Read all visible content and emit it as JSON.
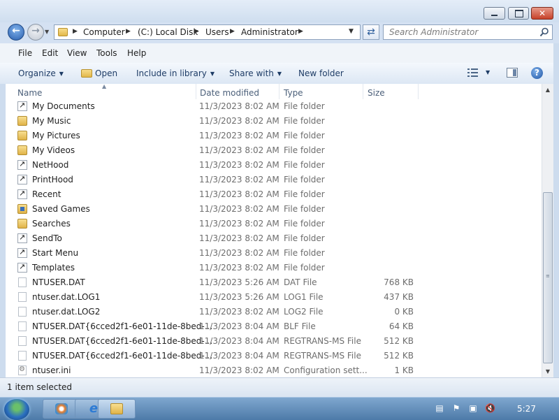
{
  "address": {
    "crumbs": [
      "Computer",
      "(C:) Local Disk",
      "Users",
      "Administrator"
    ]
  },
  "search": {
    "placeholder": "Search Administrator"
  },
  "menu": {
    "file": "File",
    "edit": "Edit",
    "view": "View",
    "tools": "Tools",
    "help": "Help"
  },
  "toolbar": {
    "organize": "Organize",
    "open": "Open",
    "include": "Include in library",
    "share": "Share with",
    "new_folder": "New folder"
  },
  "columns": {
    "name": "Name",
    "date": "Date modified",
    "type": "Type",
    "size": "Size"
  },
  "files": [
    {
      "name": "My Documents",
      "date": "11/3/2023 8:02 AM",
      "type": "File folder",
      "size": "",
      "icon": "shortcut"
    },
    {
      "name": "My Music",
      "date": "11/3/2023 8:02 AM",
      "type": "File folder",
      "size": "",
      "icon": "folder"
    },
    {
      "name": "My Pictures",
      "date": "11/3/2023 8:02 AM",
      "type": "File folder",
      "size": "",
      "icon": "folder"
    },
    {
      "name": "My Videos",
      "date": "11/3/2023 8:02 AM",
      "type": "File folder",
      "size": "",
      "icon": "folder"
    },
    {
      "name": "NetHood",
      "date": "11/3/2023 8:02 AM",
      "type": "File folder",
      "size": "",
      "icon": "shortcut"
    },
    {
      "name": "PrintHood",
      "date": "11/3/2023 8:02 AM",
      "type": "File folder",
      "size": "",
      "icon": "shortcut"
    },
    {
      "name": "Recent",
      "date": "11/3/2023 8:02 AM",
      "type": "File folder",
      "size": "",
      "icon": "shortcut"
    },
    {
      "name": "Saved Games",
      "date": "11/3/2023 8:02 AM",
      "type": "File folder",
      "size": "",
      "icon": "special"
    },
    {
      "name": "Searches",
      "date": "11/3/2023 8:02 AM",
      "type": "File folder",
      "size": "",
      "icon": "folder"
    },
    {
      "name": "SendTo",
      "date": "11/3/2023 8:02 AM",
      "type": "File folder",
      "size": "",
      "icon": "shortcut"
    },
    {
      "name": "Start Menu",
      "date": "11/3/2023 8:02 AM",
      "type": "File folder",
      "size": "",
      "icon": "shortcut"
    },
    {
      "name": "Templates",
      "date": "11/3/2023 8:02 AM",
      "type": "File folder",
      "size": "",
      "icon": "shortcut"
    },
    {
      "name": "NTUSER.DAT",
      "date": "11/3/2023 5:26 AM",
      "type": "DAT File",
      "size": "768 KB",
      "icon": "file"
    },
    {
      "name": "ntuser.dat.LOG1",
      "date": "11/3/2023 5:26 AM",
      "type": "LOG1 File",
      "size": "437 KB",
      "icon": "file"
    },
    {
      "name": "ntuser.dat.LOG2",
      "date": "11/3/2023 8:02 AM",
      "type": "LOG2 File",
      "size": "0 KB",
      "icon": "file"
    },
    {
      "name": "NTUSER.DAT{6cced2f1-6e01-11de-8bed-...",
      "date": "11/3/2023 8:04 AM",
      "type": "BLF File",
      "size": "64 KB",
      "icon": "file"
    },
    {
      "name": "NTUSER.DAT{6cced2f1-6e01-11de-8bed-...",
      "date": "11/3/2023 8:04 AM",
      "type": "REGTRANS-MS File",
      "size": "512 KB",
      "icon": "file"
    },
    {
      "name": "NTUSER.DAT{6cced2f1-6e01-11de-8bed-...",
      "date": "11/3/2023 8:04 AM",
      "type": "REGTRANS-MS File",
      "size": "512 KB",
      "icon": "file"
    },
    {
      "name": "ntuser.ini",
      "date": "11/3/2023 8:02 AM",
      "type": "Configuration sett...",
      "size": "1 KB",
      "icon": "ini"
    }
  ],
  "status": {
    "text": "1 item selected"
  },
  "taskbar": {
    "clock": "5:27"
  }
}
